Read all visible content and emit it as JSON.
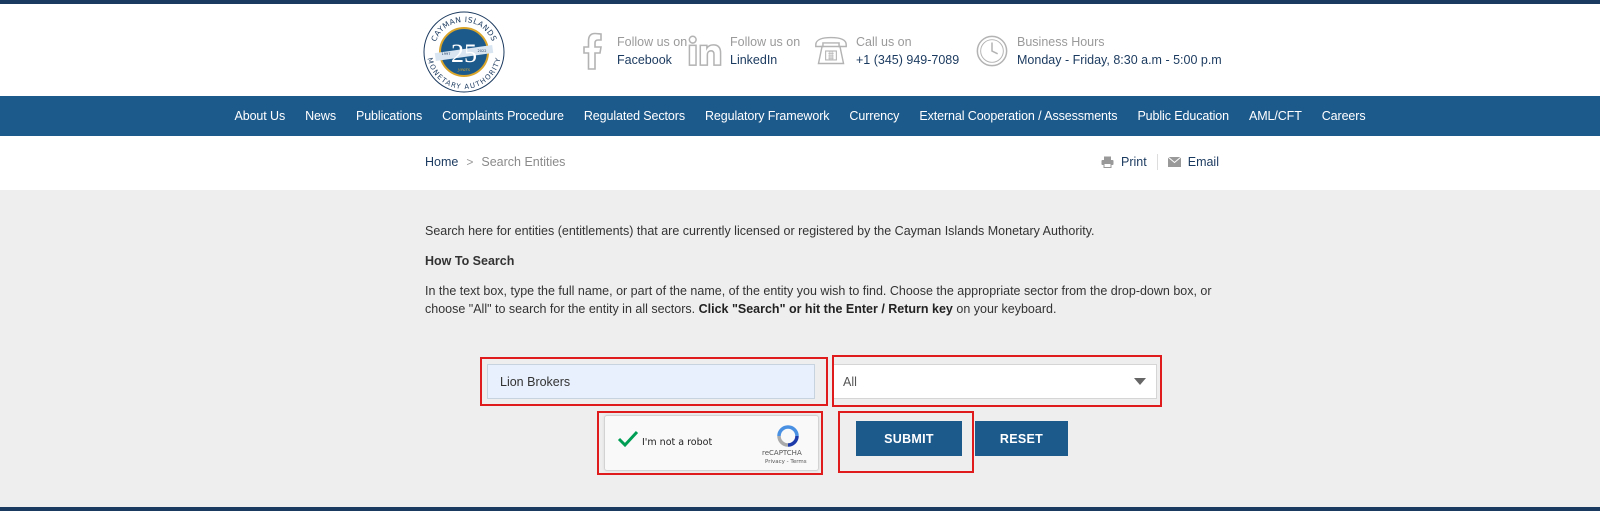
{
  "header": {
    "logo": {
      "top_text": "CAYMAN ISLANDS",
      "bottom_text": "MONETARY AUTHORITY",
      "number": "25",
      "subtext": "years",
      "left_year": "1997",
      "right_year": "2022",
      "icon": "cima-25-years-seal"
    },
    "facebook": {
      "label": "Follow us on",
      "value": "Facebook",
      "icon": "facebook-icon"
    },
    "linkedin": {
      "label": "Follow us on",
      "value": "LinkedIn",
      "icon": "linkedin-icon"
    },
    "phone": {
      "label": "Call us on",
      "value": "+1 (345) 949-7089",
      "icon": "telephone-icon"
    },
    "hours": {
      "label": "Business Hours",
      "value": "Monday - Friday, 8:30 a.m - 5:00 p.m",
      "icon": "clock-icon"
    }
  },
  "nav": {
    "items": [
      "About Us",
      "News",
      "Publications",
      "Complaints Procedure",
      "Regulated Sectors",
      "Regulatory Framework",
      "Currency",
      "External Cooperation / Assessments",
      "Public Education",
      "AML/CFT",
      "Careers"
    ]
  },
  "breadcrumb": {
    "home": "Home",
    "separator": ">",
    "current": "Search Entities"
  },
  "tools": {
    "print": "Print",
    "email": "Email"
  },
  "content": {
    "intro": "Search here for entities (entitlements) that are currently licensed or registered by the Cayman Islands Monetary Authority.",
    "howto_title": "How To Search",
    "howto_part1": "In the text box, type the full name, or part of the name, of the entity you wish to find. Choose the appropriate sector from the drop-down box, or choose \"All\" to search for the entity in all sectors. ",
    "howto_bold": "Click \"Search\" or hit the Enter / Return key",
    "howto_part2": " on your keyboard."
  },
  "form": {
    "search_value": "Lion Brokers",
    "sector_selected": "All",
    "captcha_label": "I'm not a robot",
    "captcha_brand": "reCAPTCHA",
    "captcha_terms": "Privacy - Terms",
    "submit_label": "SUBMIT",
    "reset_label": "RESET"
  },
  "colors": {
    "nav_bg": "#1d5a8c",
    "dark_navy": "#1b3a5f",
    "highlight": "#e01b1b",
    "logo_gold": "#d9a52b"
  }
}
